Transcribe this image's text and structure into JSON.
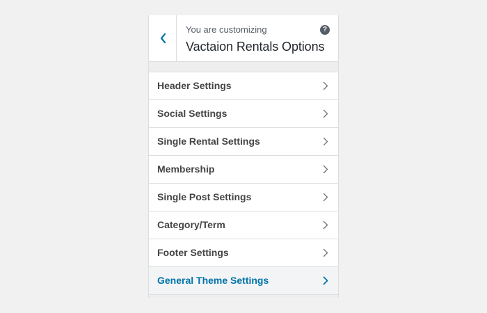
{
  "header": {
    "customizing_label": "You are customizing",
    "title": "Vactaion Rentals Options",
    "back_icon": "chevron-left-icon",
    "help_icon": "help-icon",
    "help_glyph": "?"
  },
  "sections": [
    {
      "label": "Header Settings",
      "active": false
    },
    {
      "label": "Social Settings",
      "active": false
    },
    {
      "label": "Single Rental Settings",
      "active": false
    },
    {
      "label": "Membership",
      "active": false
    },
    {
      "label": "Single Post Settings",
      "active": false
    },
    {
      "label": "Category/Term",
      "active": false
    },
    {
      "label": "Footer Settings",
      "active": false
    },
    {
      "label": "General Theme Settings",
      "active": true
    }
  ],
  "colors": {
    "accent": "#0073aa",
    "text": "#444444",
    "chevron": "#72777c"
  }
}
